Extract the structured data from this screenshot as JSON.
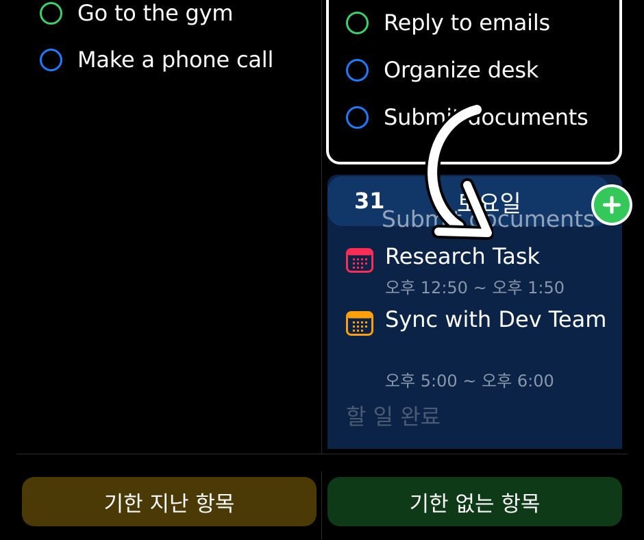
{
  "left_list": {
    "items": [
      {
        "label": "Go to the gym",
        "color": "#3cd16a"
      },
      {
        "label": "Make a phone call",
        "color": "#1f7bff"
      }
    ]
  },
  "highlight_list": {
    "items": [
      {
        "label": "Reply to emails",
        "color": "#3cd16a"
      },
      {
        "label": "Organize desk",
        "color": "#1f7bff"
      },
      {
        "label": "Submit documents",
        "color": "#1f7bff"
      }
    ]
  },
  "day": {
    "number": "31",
    "weekday": "토요일",
    "drag_ghost": "Submit documents",
    "events": [
      {
        "title": "Research Task",
        "time": "오후 12:50 ~ 오후 1:50",
        "color": "#ff2d55"
      },
      {
        "title": "Sync with Dev Team",
        "time": "오후 5:00 ~ 오후 6:00",
        "color": "#ff9f0a"
      }
    ],
    "done_label": "할 일 완료"
  },
  "buttons": {
    "overdue": "기한 지난 항목",
    "no_due": "기한 없는 항목"
  },
  "icons": {
    "add": "plus-circle-icon",
    "calendar": "calendar-icon",
    "arrow": "curved-arrow-icon"
  }
}
